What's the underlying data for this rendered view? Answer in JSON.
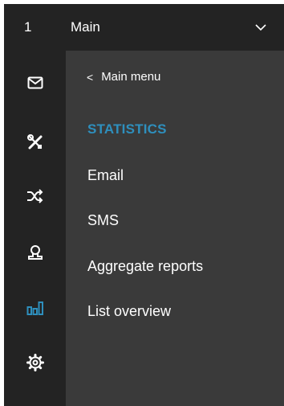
{
  "header": {
    "account_number": "1",
    "account_name": "Main"
  },
  "rail": {
    "items": [
      {
        "icon": "mail-icon",
        "active": false
      },
      {
        "icon": "tools-icon",
        "active": false
      },
      {
        "icon": "shuffle-icon",
        "active": false
      },
      {
        "icon": "contacts-icon",
        "active": false
      },
      {
        "icon": "statistics-icon",
        "active": true
      },
      {
        "icon": "gear-icon",
        "active": false
      }
    ],
    "active_color": "#2e8fbd",
    "icon_color": "#ffffff"
  },
  "panel": {
    "back_label": "Main menu",
    "back_glyph": "<",
    "section_heading": "STATISTICS",
    "items": [
      {
        "label": "Email"
      },
      {
        "label": "SMS"
      },
      {
        "label": "Aggregate reports"
      },
      {
        "label": "List overview"
      }
    ]
  }
}
